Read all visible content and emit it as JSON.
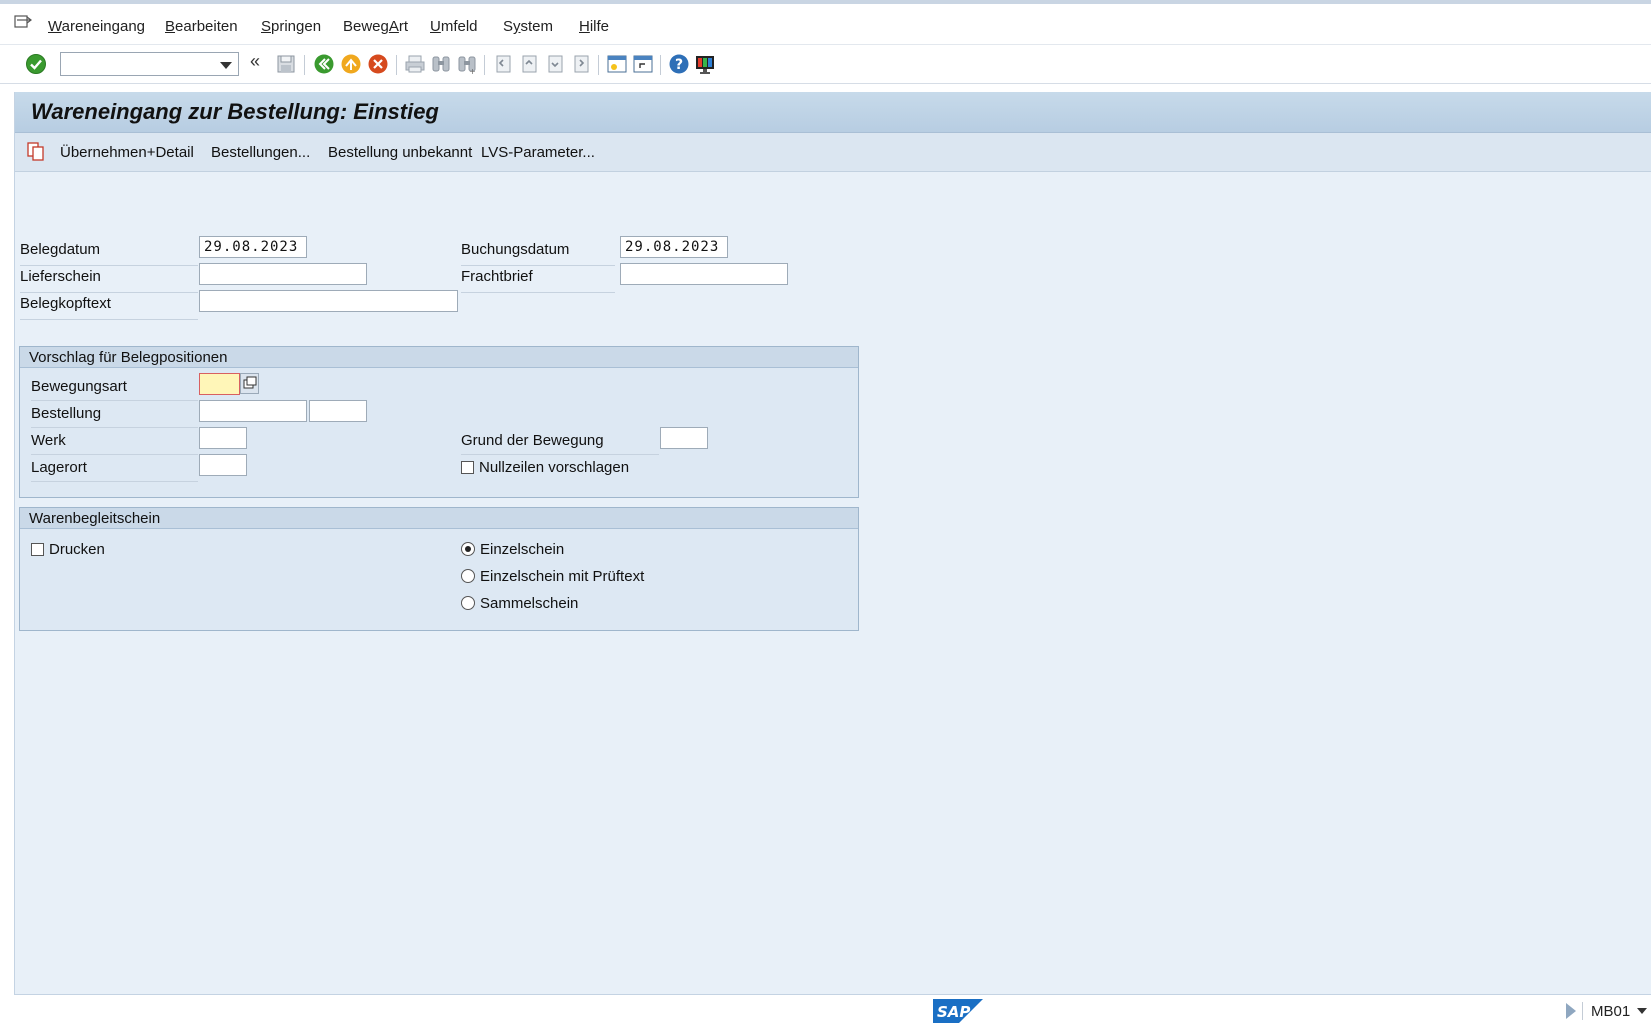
{
  "menu": {
    "items": [
      {
        "underline": "W",
        "rest": "areneingang"
      },
      {
        "underline": "B",
        "rest": "earbeiten"
      },
      {
        "underline": "S",
        "rest": "pringen"
      },
      {
        "pre": "Beweg",
        "underline": "A",
        "rest": "rt"
      },
      {
        "underline": "U",
        "rest": "mfeld"
      },
      {
        "pre": "S",
        "underline": "y",
        "rest": "stem"
      },
      {
        "underline": "H",
        "rest": "ilfe"
      }
    ]
  },
  "toolbar": {
    "command_value": "",
    "collapse_glyph": "«"
  },
  "page": {
    "title": "Wareneingang zur Bestellung: Einstieg",
    "app_buttons": {
      "take_detail": "Übernehmen+Detail",
      "orders": "Bestellungen...",
      "order_unknown": "Bestellung unbekannt",
      "lvs": "LVS-Parameter..."
    }
  },
  "header": {
    "belegdatum_label": "Belegdatum",
    "belegdatum_value": "29.08.2023",
    "buchungsdatum_label": "Buchungsdatum",
    "buchungsdatum_value": "29.08.2023",
    "lieferschein_label": "Lieferschein",
    "lieferschein_value": "",
    "frachtbrief_label": "Frachtbrief",
    "frachtbrief_value": "",
    "belegkopftext_label": "Belegkopftext",
    "belegkopftext_value": ""
  },
  "vorschlag": {
    "title": "Vorschlag für Belegpositionen",
    "bewegungsart_label": "Bewegungsart",
    "bewegungsart_value": "",
    "bestellung_label": "Bestellung",
    "bestellung_value": "",
    "bestellung_pos_value": "",
    "werk_label": "Werk",
    "werk_value": "",
    "lagerort_label": "Lagerort",
    "lagerort_value": "",
    "grund_label": "Grund der Bewegung",
    "grund_value": "",
    "nullzeilen_label": "Nullzeilen vorschlagen",
    "nullzeilen_checked": false
  },
  "warenbegleitschein": {
    "title": "Warenbegleitschein",
    "drucken_label": "Drucken",
    "drucken_checked": false,
    "options": [
      "Einzelschein",
      "Einzelschein mit Prüftext",
      "Sammelschein"
    ],
    "selected": "Einzelschein"
  },
  "status": {
    "logo_text": "SAP",
    "transaction": "MB01"
  },
  "colors": {
    "accept_green": "#3a9a2f",
    "cancel_red": "#d64a1e",
    "exit_orange": "#f0a81e",
    "sap_blue": "#1a6fc4"
  }
}
